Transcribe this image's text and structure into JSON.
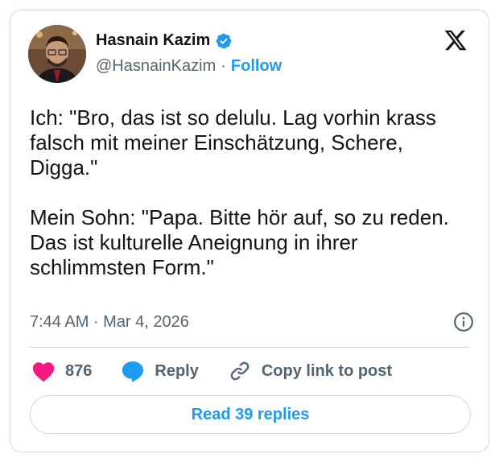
{
  "author": {
    "name": "Hasnain Kazim",
    "handle": "@HasnainKazim",
    "separator": "·",
    "follow_label": "Follow"
  },
  "tweet": {
    "text": "Ich: \"Bro, das ist so delulu. Lag vorhin krass falsch mit meiner Einschätzung, Schere, Digga.\"\n\nMein Sohn: \"Papa. Bitte hör auf, so zu reden. Das ist kulturelle Aneignung in ihrer schlimmsten Form.\"",
    "timestamp": "7:44 AM · Mar 4, 2026"
  },
  "actions": {
    "like_count": "876",
    "reply_label": "Reply",
    "copy_link_label": "Copy link to post"
  },
  "read_replies_label": "Read 39 replies",
  "colors": {
    "accent": "#1d9bf0",
    "like": "#f91880",
    "text": "#0f1419",
    "secondary": "#536471"
  },
  "icons": [
    "verified-badge-icon",
    "x-logo-icon",
    "info-icon",
    "heart-icon",
    "reply-bubble-icon",
    "link-icon"
  ]
}
